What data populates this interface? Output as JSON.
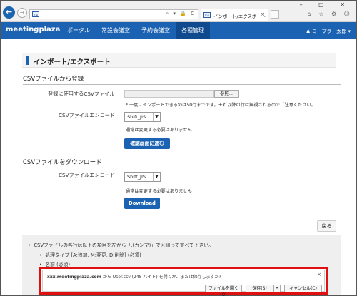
{
  "browser": {
    "favicon_text": "mp",
    "address_icons": "⌕ ▾ 🔒 C",
    "tab_title": "インポート/エクスポート",
    "tab_close": "×",
    "window_controls": "– □ ✕",
    "toolbar_icons": "⌂ ☆ ⚙ ☺"
  },
  "app": {
    "logo": "meetingplaza",
    "menu": [
      {
        "label": "ポータル"
      },
      {
        "label": "常設会議室"
      },
      {
        "label": "予約会議室"
      },
      {
        "label": "各種管理"
      }
    ],
    "active_menu": "各種管理",
    "user_org": "♟ ミープラ",
    "user_name": "太郎 ▾",
    "brand_color": "#1b62b3"
  },
  "page": {
    "title": "インポート/エクスポート",
    "import_section": {
      "heading": "CSVファイルから登録",
      "file_label": "登録に使用するCSVファイル",
      "browse_label": "参照...",
      "file_note": "* 一度にインポートできるのは50行までです。それ以降の行は無視されるのでご注意ください。",
      "encoding_label": "CSVファイルエンコード",
      "encoding_value": "Shift_JIS",
      "encoding_note": "通常は変更する必要はありません",
      "confirm_button": "確認画面に進む"
    },
    "export_section": {
      "heading": "CSVファイルをダウンロード",
      "encoding_label": "CSVファイルエンコード",
      "encoding_value": "Shift_JIS",
      "encoding_note": "通常は変更する必要はありません",
      "download_button": "Download"
    },
    "back_button": "戻る",
    "info": {
      "intro": "CSVファイルの各行は以下の項目を左から「,(カンマ)」で区切って並べて下さい。",
      "items": [
        "処理タイプ [A:追加, M:変更, D:削除] (必須)",
        "名前 (必須)"
      ]
    }
  },
  "download_bar": {
    "site": "xxx.meetingplaza.com",
    "message": " から User.csv (248 バイト) を開くか、または保存しますか?",
    "open_button": "ファイルを開く(O)",
    "save_button": "保存(S)",
    "save_split": "▾",
    "cancel_button": "キャンセル(C)",
    "close": "×",
    "highlight_color": "#e01010"
  }
}
